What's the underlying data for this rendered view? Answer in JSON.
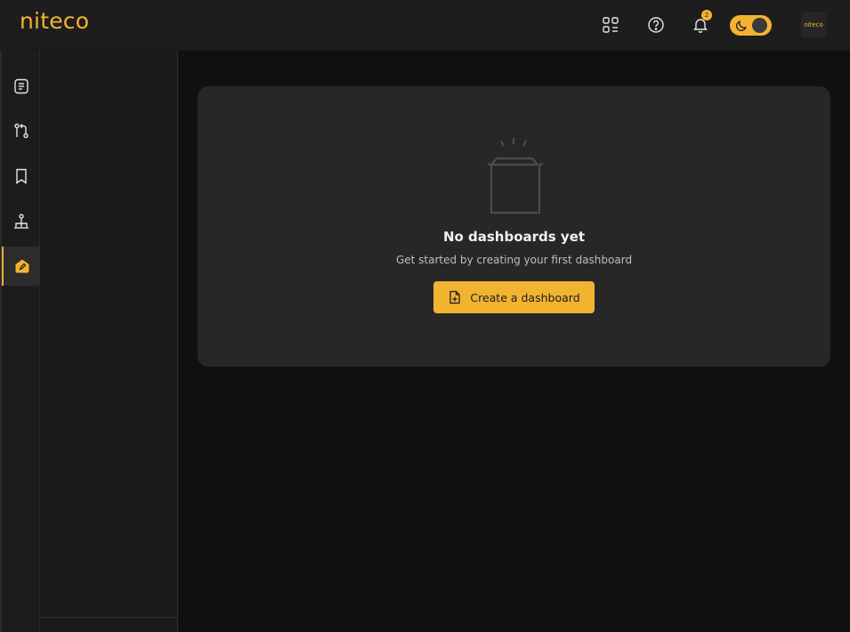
{
  "brand": {
    "logo_text": "niteco",
    "accent": "#f2b331"
  },
  "header": {
    "apps_icon": "apps-grid-icon",
    "help_icon": "help-circle-icon",
    "notifications": {
      "icon": "bell-icon",
      "count": "2"
    },
    "theme_toggle": {
      "icon": "moon-icon",
      "state": "dark"
    },
    "avatar_text": "niteco"
  },
  "rail": {
    "items": [
      {
        "icon": "document-list-icon",
        "active": false
      },
      {
        "icon": "pull-request-icon",
        "active": false
      },
      {
        "icon": "bookmark-icon",
        "active": false
      },
      {
        "icon": "hierarchy-icon",
        "active": false
      },
      {
        "icon": "dashboard-edit-icon",
        "active": true
      }
    ]
  },
  "empty_state": {
    "illustration": "open-box-icon",
    "title": "No dashboards yet",
    "subtitle": "Get started by creating your first dashboard",
    "button_label": "Create a dashboard",
    "button_icon": "add-file-icon"
  }
}
